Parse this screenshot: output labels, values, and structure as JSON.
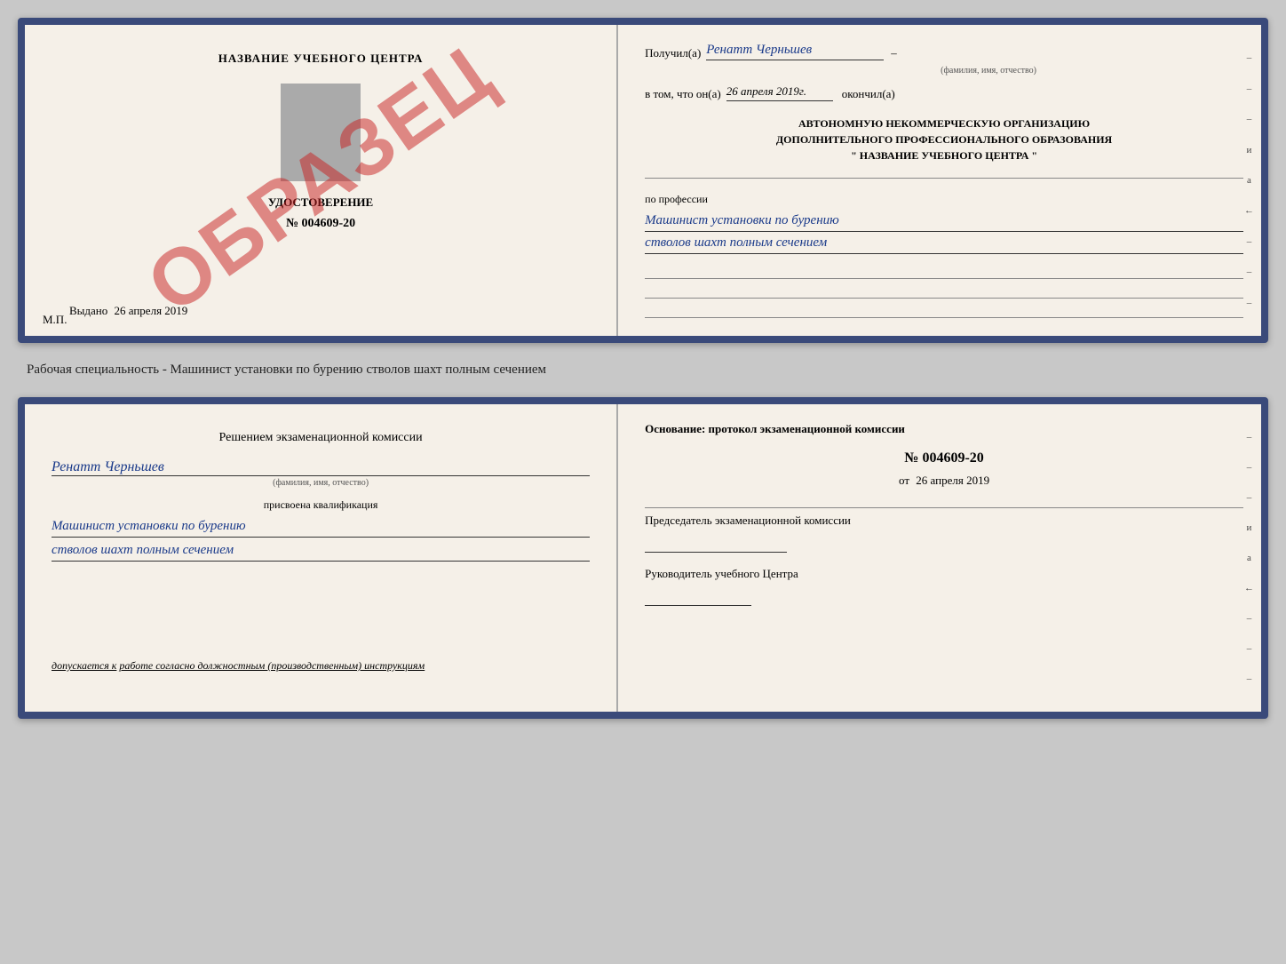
{
  "top_card": {
    "left": {
      "title": "НАЗВАНИЕ УЧЕБНОГО ЦЕНТРА",
      "udostoverenie_label": "УДОСТОВЕРЕНИЕ",
      "number": "№ 004609-20",
      "vydano_label": "Выдано",
      "vydano_date": "26 апреля 2019",
      "mp": "М.П.",
      "watermark": "ОБРАЗЕЦ"
    },
    "right": {
      "poluchil_label": "Получил(а)",
      "poluchil_name": "Ренатт Черньшев",
      "fio_label": "(фамилия, имя, отчество)",
      "vtom_label": "в том, что он(а)",
      "vtom_date": "26 апреля 2019г.",
      "okonchil_label": "окончил(а)",
      "org_line1": "АВТОНОМНУЮ НЕКОММЕРЧЕСКУЮ ОРГАНИЗАЦИЮ",
      "org_line2": "ДОПОЛНИТЕЛЬНОГО ПРОФЕССИОНАЛЬНОГО ОБРАЗОВАНИЯ",
      "org_line3": "\"    НАЗВАНИЕ УЧЕБНОГО ЦЕНТРА    \"",
      "po_professii": "по профессии",
      "profession_line1": "Машинист установки по бурению",
      "profession_line2": "стволов шахт полным сечением"
    }
  },
  "specialty_text": "Рабочая специальность - Машинист установки по бурению стволов шахт полным сечением",
  "bottom_card": {
    "left": {
      "komissia_title": "Решением экзаменационной комиссии",
      "name": "Ренатт Черньшев",
      "fio_label": "(фамилия, имя, отчество)",
      "prisvoena_label": "присвоена квалификация",
      "kvalif_line1": "Машинист установки по бурению",
      "kvalif_line2": "стволов шахт полным сечением",
      "dopuskaetsya_label": "допускается к",
      "dopuskaetsya_val": "работе согласно должностным (производственным) инструкциям"
    },
    "right": {
      "osnov_title": "Основание: протокол экзаменационной комиссии",
      "protocol_num": "№  004609-20",
      "ot_label": "от",
      "ot_date": "26 апреля 2019",
      "chairman_label": "Председатель экзаменационной комиссии",
      "rukovoditel_label": "Руководитель учебного Центра"
    }
  },
  "side_marks": {
    "items": [
      "–",
      "–",
      "–",
      "и",
      "а",
      "←",
      "–",
      "–",
      "–"
    ]
  }
}
